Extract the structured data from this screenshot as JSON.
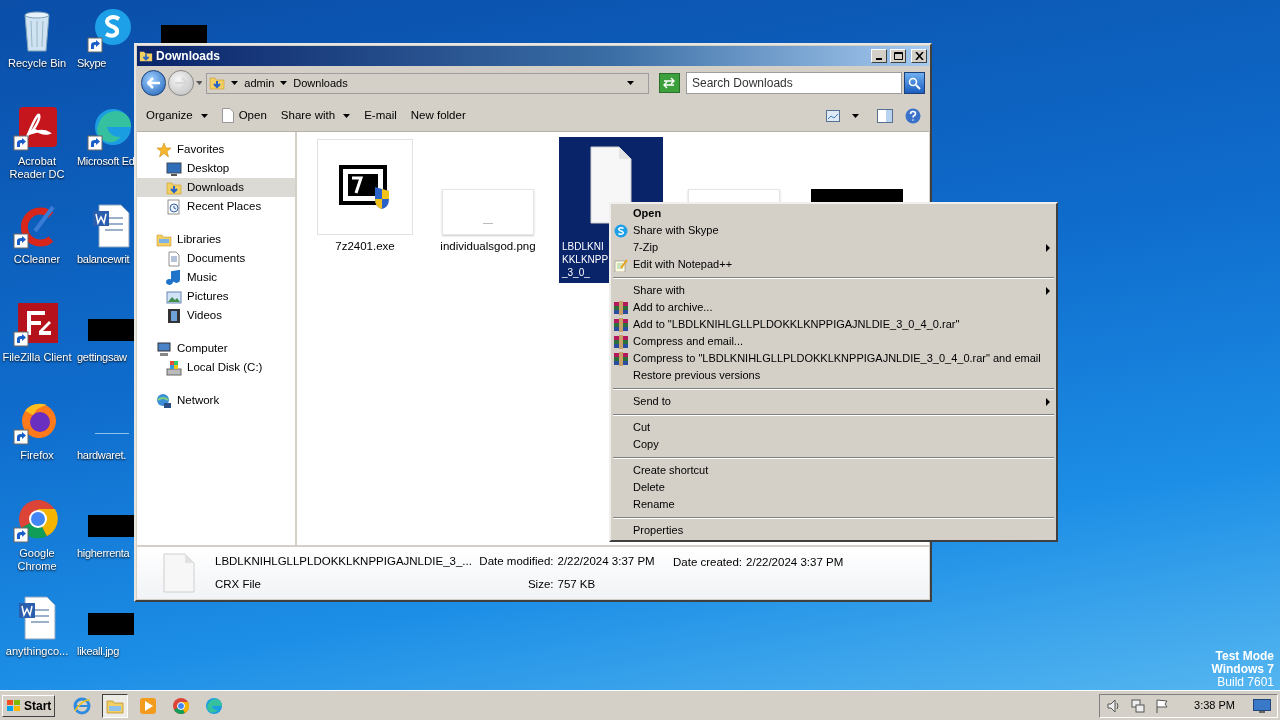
{
  "desktop": {
    "columns": [
      {
        "icons": [
          {
            "label": "Recycle Bin",
            "kind": "recycle",
            "shortcut": false
          },
          {
            "label": "Acrobat Reader DC",
            "kind": "acrobat",
            "shortcut": true
          },
          {
            "label": "CCleaner",
            "kind": "ccleaner",
            "shortcut": true
          },
          {
            "label": "FileZilla Client",
            "kind": "filezilla",
            "shortcut": true
          },
          {
            "label": "Firefox",
            "kind": "firefox",
            "shortcut": true
          },
          {
            "label": "Google Chrome",
            "kind": "chrome",
            "shortcut": true
          },
          {
            "label": "anythingco...",
            "kind": "word",
            "shortcut": false
          }
        ]
      },
      {
        "icons": [
          {
            "label": "Skype",
            "kind": "skype",
            "shortcut": true
          },
          {
            "label": "Microsoft Ed",
            "kind": "edge",
            "shortcut": true
          },
          {
            "label": "balancewrit",
            "kind": "word",
            "shortcut": false
          },
          {
            "label": "gettingsaw",
            "kind": "redacted",
            "shortcut": false
          },
          {
            "label": "hardwaret.",
            "kind": "blank",
            "shortcut": false
          },
          {
            "label": "higherrenta",
            "kind": "redacted",
            "shortcut": false
          },
          {
            "label": "likeall.jpg",
            "kind": "redacted",
            "shortcut": false
          }
        ]
      },
      {
        "icons": [
          {
            "kind": "strip"
          }
        ]
      }
    ]
  },
  "window": {
    "title": "Downloads",
    "breadcrumb": [
      "admin",
      "Downloads"
    ],
    "search": {
      "placeholder": "Search Downloads"
    },
    "toolbar": [
      {
        "label": "Organize",
        "kind": "menu"
      },
      {
        "label": "Open",
        "kind": "open"
      },
      {
        "label": "Share with",
        "kind": "menu"
      },
      {
        "label": "E-mail",
        "kind": "plain"
      },
      {
        "label": "New folder",
        "kind": "plain"
      }
    ],
    "nav": [
      {
        "label": "Favorites",
        "kind": "star",
        "selected": false,
        "children": [
          {
            "label": "Desktop",
            "kind": "desktop",
            "selected": false
          },
          {
            "label": "Downloads",
            "kind": "downloads",
            "selected": true
          },
          {
            "label": "Recent Places",
            "kind": "recent",
            "selected": false
          }
        ]
      },
      {
        "label": "Libraries",
        "kind": "libraries",
        "selected": false,
        "children": [
          {
            "label": "Documents",
            "kind": "documents",
            "selected": false
          },
          {
            "label": "Music",
            "kind": "music",
            "selected": false
          },
          {
            "label": "Pictures",
            "kind": "pictures",
            "selected": false
          },
          {
            "label": "Videos",
            "kind": "videos",
            "selected": false
          }
        ]
      },
      {
        "label": "Computer",
        "kind": "computer",
        "selected": false,
        "children": [
          {
            "label": "Local Disk (C:)",
            "kind": "disk",
            "selected": false
          }
        ]
      },
      {
        "label": "Network",
        "kind": "network",
        "selected": false
      }
    ],
    "files": [
      {
        "label_lines": [
          "7z2401.exe"
        ],
        "kind": "exe",
        "selected": false
      },
      {
        "label_lines": [
          "individualsgod.png"
        ],
        "kind": "blank_thumb",
        "selected": false
      },
      {
        "label_lines": [
          "LBDLKNI",
          "KKLKNPP",
          "_3_0_"
        ],
        "kind": "document",
        "selected": true
      },
      {
        "kind": "blank_thumb",
        "selected": false
      },
      {
        "kind": "redacted",
        "selected": false
      }
    ],
    "details": {
      "name": "LBDLKNIHLGLLPLDOKKLKNPPIGAJNLDIE_3_...",
      "type": "CRX File",
      "fields": [
        {
          "label": "Date modified:",
          "value": "2/22/2024 3:37 PM"
        },
        {
          "label": "Size:",
          "value": "757 KB"
        },
        {
          "label": "Date created:",
          "value": "2/22/2024 3:37 PM"
        }
      ]
    }
  },
  "context_menu": [
    {
      "kind": "item",
      "label": "Open",
      "default": true,
      "submenu": false
    },
    {
      "kind": "skype",
      "label": "Share with Skype",
      "default": false,
      "submenu": false
    },
    {
      "kind": "item",
      "label": "7-Zip",
      "default": false,
      "submenu": true
    },
    {
      "kind": "notepad",
      "label": "Edit with Notepad++",
      "default": false,
      "submenu": false
    },
    {
      "kind": "separator"
    },
    {
      "kind": "item",
      "label": "Share with",
      "default": false,
      "submenu": true
    },
    {
      "kind": "archive",
      "label": "Add to archive...",
      "default": false,
      "submenu": false
    },
    {
      "kind": "archive",
      "label": "Add to \"LBDLKNIHLGLLPLDOKKLKNPPIGAJNLDIE_3_0_4_0.rar\"",
      "default": false,
      "submenu": false
    },
    {
      "kind": "archive",
      "label": "Compress and email...",
      "default": false,
      "submenu": false
    },
    {
      "kind": "archive",
      "label": "Compress to \"LBDLKNIHLGLLPLDOKKLKNPPIGAJNLDIE_3_0_4_0.rar\" and email",
      "default": false,
      "submenu": false
    },
    {
      "kind": "item",
      "label": "Restore previous versions",
      "default": false,
      "submenu": false
    },
    {
      "kind": "separator"
    },
    {
      "kind": "item",
      "label": "Send to",
      "default": false,
      "submenu": true
    },
    {
      "kind": "separator"
    },
    {
      "kind": "item",
      "label": "Cut",
      "default": false,
      "submenu": false
    },
    {
      "kind": "item",
      "label": "Copy",
      "default": false,
      "submenu": false
    },
    {
      "kind": "separator"
    },
    {
      "kind": "item",
      "label": "Create shortcut",
      "default": false,
      "submenu": false
    },
    {
      "kind": "item",
      "label": "Delete",
      "default": false,
      "submenu": false
    },
    {
      "kind": "item",
      "label": "Rename",
      "default": false,
      "submenu": false
    },
    {
      "kind": "separator"
    },
    {
      "kind": "item",
      "label": "Properties",
      "default": false,
      "submenu": false
    }
  ],
  "os_notice": [
    {
      "text": "Test Mode",
      "bold": true
    },
    {
      "text": "Windows 7",
      "bold": true
    },
    {
      "text": "Build 7601",
      "bold": false
    }
  ],
  "taskbar": {
    "start": "Start",
    "apps": [
      {
        "kind": "ie",
        "selected": false
      },
      {
        "kind": "explorer",
        "selected": true
      },
      {
        "kind": "media",
        "selected": false
      },
      {
        "kind": "chrome",
        "selected": false
      },
      {
        "kind": "edge",
        "selected": false
      }
    ],
    "clock": "3:38 PM"
  }
}
